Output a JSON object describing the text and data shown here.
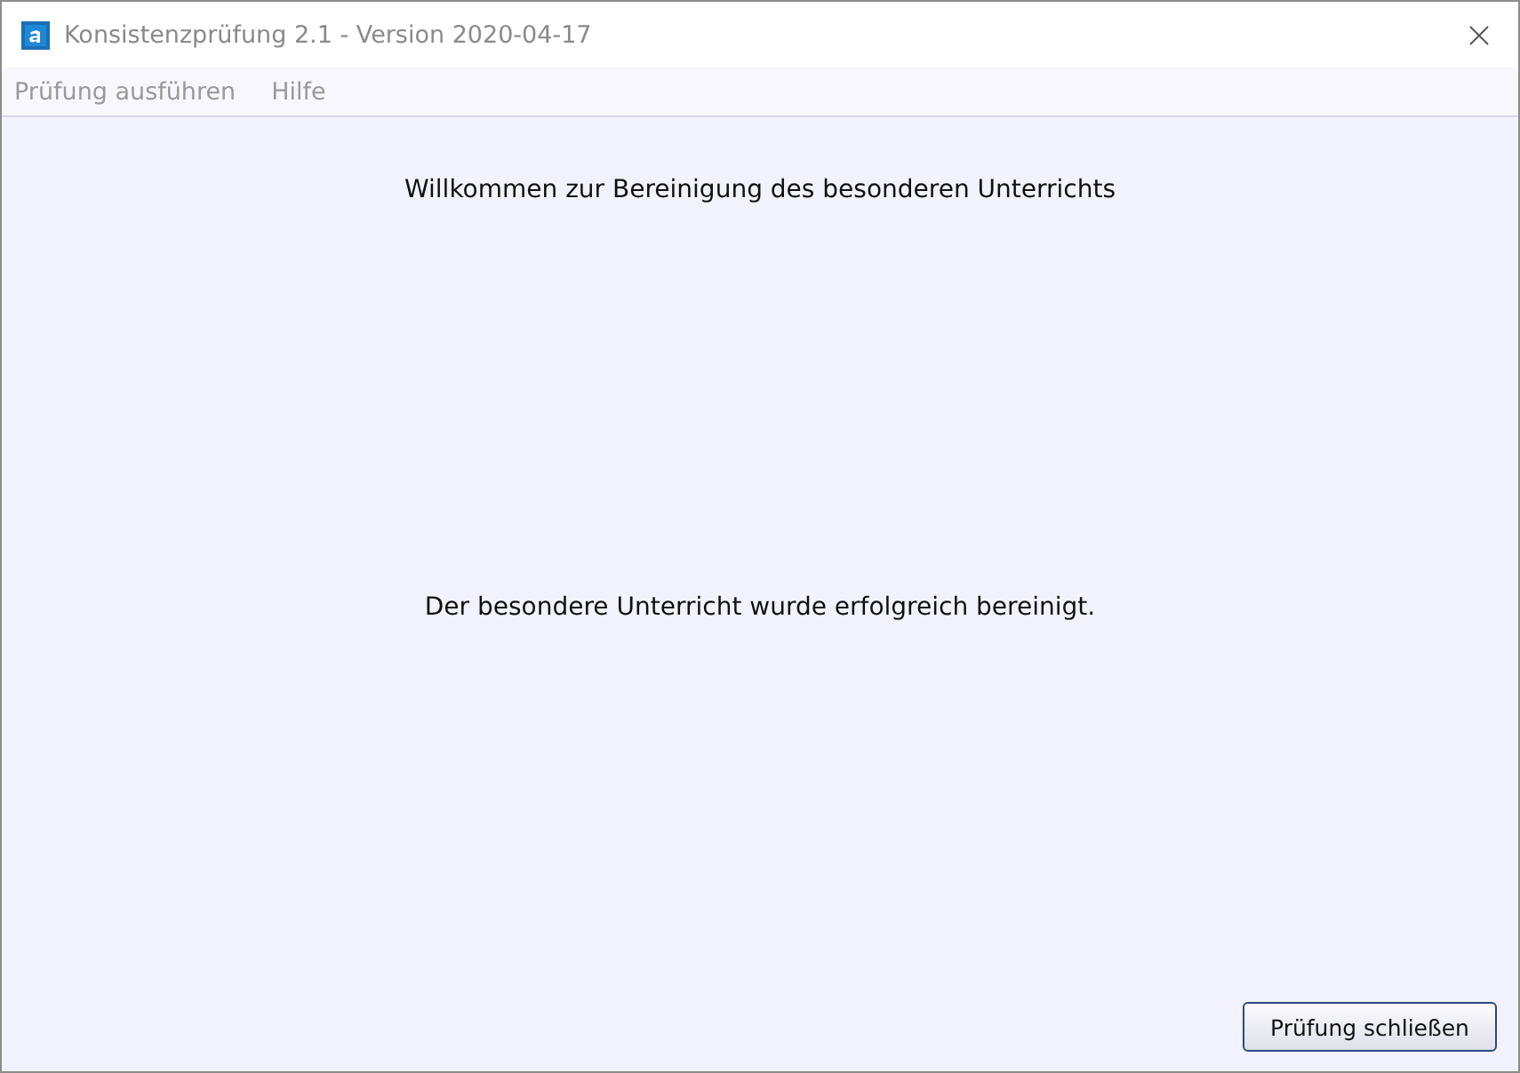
{
  "window": {
    "title": "Konsistenzprüfung 2.1 - Version 2020-04-17"
  },
  "menu": [
    "Prüfung ausführen",
    "Hilfe"
  ],
  "heading": "Willkommen zur Bereinigung des besonderen Unterrichts",
  "message": "Der besondere Unterricht wurde erfolgreich bereinigt.",
  "buttons": [
    "Prüfung schließen"
  ]
}
